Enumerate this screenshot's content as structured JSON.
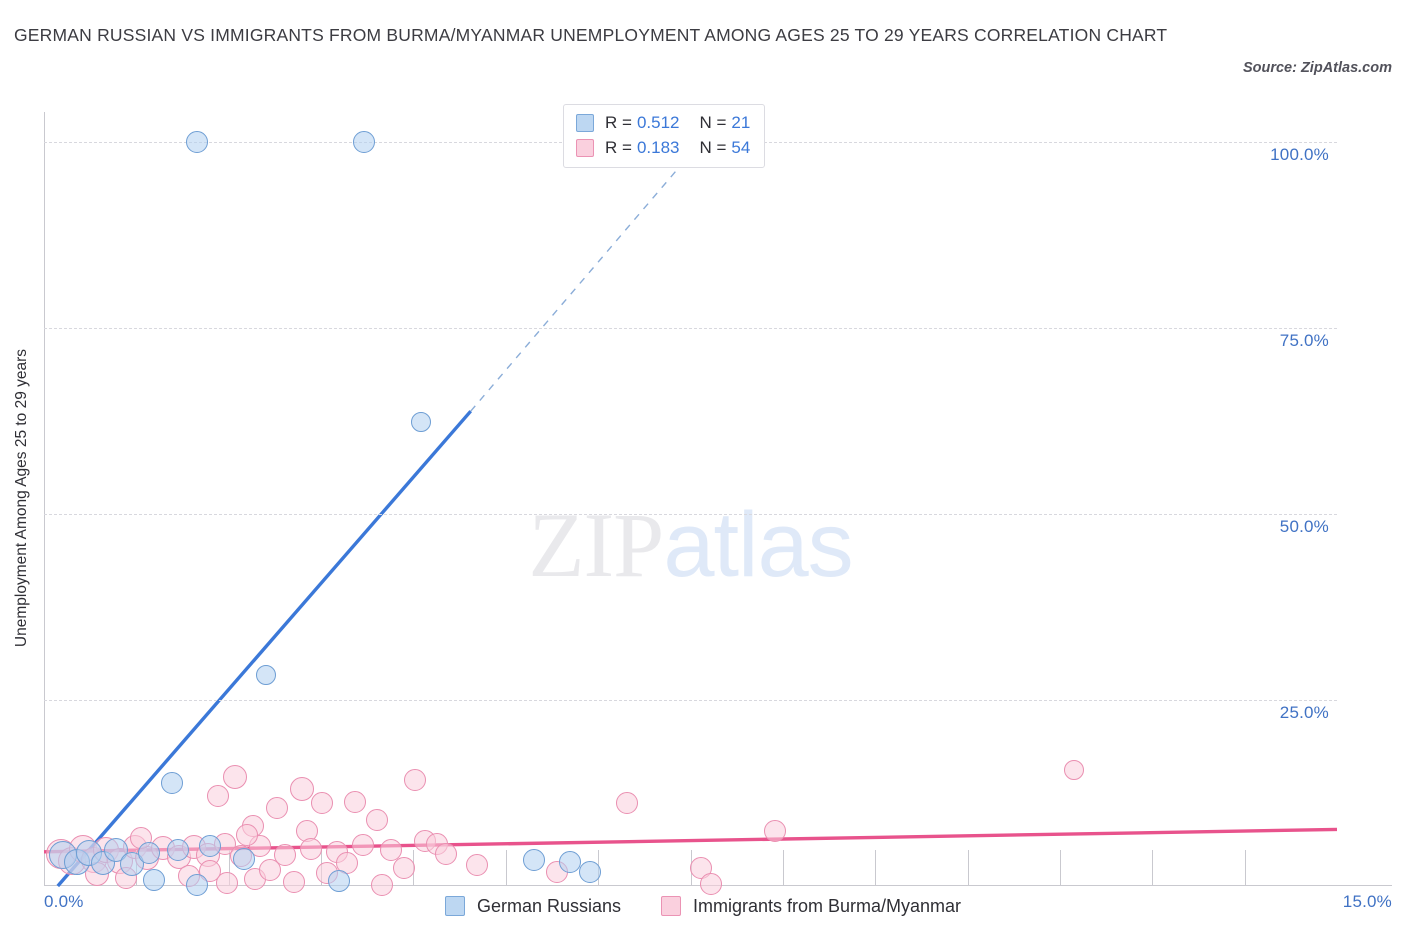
{
  "header": {
    "title": "GERMAN RUSSIAN VS IMMIGRANTS FROM BURMA/MYANMAR UNEMPLOYMENT AMONG AGES 25 TO 29 YEARS CORRELATION CHART",
    "source": "Source: ZipAtlas.com"
  },
  "watermark": {
    "part1": "ZIP",
    "part2": "atlas"
  },
  "stats": {
    "rows": [
      {
        "series": "German Russians",
        "color": "#bdd7f2",
        "r_label": "R = ",
        "r_value": "0.512",
        "n_label": "N = ",
        "n_value": "21"
      },
      {
        "series": "Immigrants from Burma/Myanmar",
        "color": "#fad0de",
        "r_label": "R = ",
        "r_value": "0.183",
        "n_label": "N = ",
        "n_value": "54"
      }
    ]
  },
  "legend": {
    "items": [
      {
        "label": "German Russians",
        "color": "#bdd7f2"
      },
      {
        "label": "Immigrants from Burma/Myanmar",
        "color": "#fad0de"
      }
    ]
  },
  "chart_data": {
    "type": "scatter",
    "title": "GERMAN RUSSIAN VS IMMIGRANTS FROM BURMA/MYANMAR UNEMPLOYMENT AMONG AGES 25 TO 29 YEARS CORRELATION CHART",
    "xlabel": "",
    "ylabel": "Unemployment Among Ages 25 to 29 years",
    "xlim": [
      0,
      15
    ],
    "ylim": [
      0,
      104
    ],
    "grid": true,
    "legend_position": "bottom-center",
    "x_ticks": [
      "0.0%",
      "15.0%"
    ],
    "x_tick_values": [
      0,
      15
    ],
    "y_ticks": [
      "25.0%",
      "50.0%",
      "75.0%",
      "100.0%"
    ],
    "y_tick_values": [
      25,
      50,
      75,
      100
    ],
    "accent_blue": "#3b78d8",
    "accent_pink": "#e8538c",
    "series": [
      {
        "name": "German Russians",
        "color": "#bdd7f2",
        "edge": "#6e9ed4",
        "r": 0.512,
        "n": 21,
        "trend": {
          "x0": 0.16,
          "y0": 0.0,
          "x1": 4.95,
          "y1": 63.8,
          "dashed_to_x": 7.4,
          "dashed_to_y": 97.0
        },
        "points": [
          {
            "x": 1.77,
            "y": 100.0,
            "r": 11
          },
          {
            "x": 3.71,
            "y": 100.0,
            "r": 11
          },
          {
            "x": 4.37,
            "y": 62.3,
            "r": 10
          },
          {
            "x": 2.57,
            "y": 28.4,
            "r": 10
          },
          {
            "x": 1.48,
            "y": 13.9,
            "r": 11
          },
          {
            "x": 0.22,
            "y": 4.1,
            "r": 14
          },
          {
            "x": 0.38,
            "y": 3.2,
            "r": 13
          },
          {
            "x": 0.52,
            "y": 4.5,
            "r": 13
          },
          {
            "x": 0.68,
            "y": 3.1,
            "r": 12
          },
          {
            "x": 0.84,
            "y": 4.8,
            "r": 12
          },
          {
            "x": 1.02,
            "y": 3.0,
            "r": 12
          },
          {
            "x": 1.22,
            "y": 4.4,
            "r": 11
          },
          {
            "x": 1.55,
            "y": 4.9,
            "r": 11
          },
          {
            "x": 1.92,
            "y": 5.4,
            "r": 11
          },
          {
            "x": 2.32,
            "y": 3.6,
            "r": 11
          },
          {
            "x": 1.28,
            "y": 0.8,
            "r": 11
          },
          {
            "x": 1.77,
            "y": 0.2,
            "r": 11
          },
          {
            "x": 3.42,
            "y": 0.7,
            "r": 11
          },
          {
            "x": 5.68,
            "y": 3.5,
            "r": 11
          },
          {
            "x": 6.1,
            "y": 3.2,
            "r": 11
          },
          {
            "x": 6.33,
            "y": 1.9,
            "r": 11
          }
        ]
      },
      {
        "name": "Immigrants from Burma/Myanmar",
        "color": "#fad0de",
        "edge": "#ea8fb1",
        "r": 0.183,
        "n": 54,
        "trend": {
          "x0": 0.0,
          "y0": 4.6,
          "x1": 15.0,
          "y1": 7.6
        },
        "points": [
          {
            "x": 11.95,
            "y": 15.6,
            "r": 10
          },
          {
            "x": 6.76,
            "y": 11.1,
            "r": 11
          },
          {
            "x": 4.3,
            "y": 14.2,
            "r": 11
          },
          {
            "x": 2.21,
            "y": 14.7,
            "r": 12
          },
          {
            "x": 2.99,
            "y": 13.1,
            "r": 12
          },
          {
            "x": 2.02,
            "y": 12.1,
            "r": 11
          },
          {
            "x": 3.23,
            "y": 11.2,
            "r": 11
          },
          {
            "x": 3.61,
            "y": 11.3,
            "r": 11
          },
          {
            "x": 2.7,
            "y": 10.5,
            "r": 11
          },
          {
            "x": 3.86,
            "y": 8.9,
            "r": 11
          },
          {
            "x": 8.48,
            "y": 7.4,
            "r": 11
          },
          {
            "x": 2.43,
            "y": 8.1,
            "r": 11
          },
          {
            "x": 3.05,
            "y": 7.4,
            "r": 11
          },
          {
            "x": 4.42,
            "y": 6.1,
            "r": 11
          },
          {
            "x": 4.56,
            "y": 5.6,
            "r": 11
          },
          {
            "x": 4.66,
            "y": 4.3,
            "r": 11
          },
          {
            "x": 5.02,
            "y": 2.8,
            "r": 11
          },
          {
            "x": 5.95,
            "y": 1.9,
            "r": 11
          },
          {
            "x": 7.62,
            "y": 2.4,
            "r": 11
          },
          {
            "x": 7.74,
            "y": 0.3,
            "r": 11
          },
          {
            "x": 0.2,
            "y": 4.3,
            "r": 15
          },
          {
            "x": 0.33,
            "y": 3.3,
            "r": 14
          },
          {
            "x": 0.45,
            "y": 5.0,
            "r": 14
          },
          {
            "x": 0.58,
            "y": 3.5,
            "r": 13
          },
          {
            "x": 0.72,
            "y": 4.9,
            "r": 13
          },
          {
            "x": 0.88,
            "y": 3.4,
            "r": 13
          },
          {
            "x": 1.05,
            "y": 5.2,
            "r": 12
          },
          {
            "x": 1.2,
            "y": 3.7,
            "r": 12
          },
          {
            "x": 1.38,
            "y": 5.1,
            "r": 12
          },
          {
            "x": 1.57,
            "y": 3.9,
            "r": 12
          },
          {
            "x": 1.74,
            "y": 5.3,
            "r": 12
          },
          {
            "x": 1.9,
            "y": 4.1,
            "r": 12
          },
          {
            "x": 2.1,
            "y": 5.6,
            "r": 11
          },
          {
            "x": 2.28,
            "y": 4.0,
            "r": 11
          },
          {
            "x": 2.5,
            "y": 5.4,
            "r": 11
          },
          {
            "x": 2.8,
            "y": 4.2,
            "r": 11
          },
          {
            "x": 3.1,
            "y": 5.0,
            "r": 11
          },
          {
            "x": 3.4,
            "y": 4.6,
            "r": 11
          },
          {
            "x": 3.7,
            "y": 5.5,
            "r": 11
          },
          {
            "x": 4.02,
            "y": 4.8,
            "r": 11
          },
          {
            "x": 1.68,
            "y": 1.3,
            "r": 11
          },
          {
            "x": 2.12,
            "y": 0.4,
            "r": 11
          },
          {
            "x": 2.45,
            "y": 1.0,
            "r": 11
          },
          {
            "x": 2.9,
            "y": 0.6,
            "r": 11
          },
          {
            "x": 3.92,
            "y": 0.2,
            "r": 11
          },
          {
            "x": 0.95,
            "y": 1.1,
            "r": 11
          },
          {
            "x": 1.92,
            "y": 2.0,
            "r": 11
          },
          {
            "x": 2.62,
            "y": 2.2,
            "r": 11
          },
          {
            "x": 3.28,
            "y": 1.8,
            "r": 11
          },
          {
            "x": 4.18,
            "y": 2.4,
            "r": 11
          },
          {
            "x": 0.62,
            "y": 1.6,
            "r": 12
          },
          {
            "x": 1.12,
            "y": 6.4,
            "r": 11
          },
          {
            "x": 2.35,
            "y": 6.8,
            "r": 11
          },
          {
            "x": 3.52,
            "y": 3.1,
            "r": 11
          }
        ]
      }
    ]
  }
}
